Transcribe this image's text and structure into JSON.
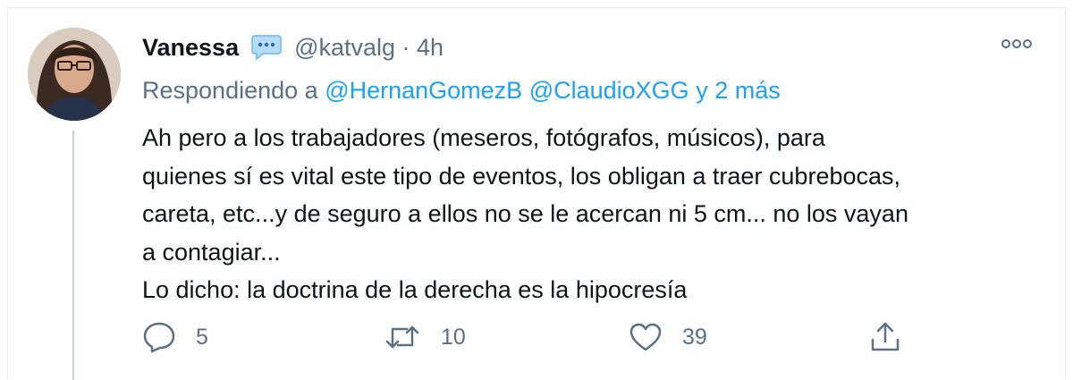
{
  "tweet": {
    "author": {
      "name": "Vanessa",
      "badge_icon": "speech-bubble-icon",
      "handle_time": "@katvalg · 4h"
    },
    "reply": {
      "prefix": "Respondiendo a",
      "mentions": [
        "@HernanGomezB",
        "@ClaudioXGG"
      ],
      "suffix": "y 2 más"
    },
    "body_lines": [
      "Ah pero a los trabajadores (meseros, fotógrafos, músicos), para",
      "quienes sí es vital este tipo de eventos, los obligan a traer cubrebocas,",
      "careta, etc...y de seguro a ellos no se le acercan ni 5 cm... no los vayan",
      "a contagiar...",
      "Lo dicho: la doctrina de la derecha es la hipocresía"
    ],
    "actions": {
      "reply_count": "5",
      "retweet_count": "10",
      "like_count": "39"
    }
  },
  "colors": {
    "secondary": "#5b7083",
    "accent": "#1da1f2",
    "text": "#0f1419",
    "border": "#e6ecf0"
  }
}
